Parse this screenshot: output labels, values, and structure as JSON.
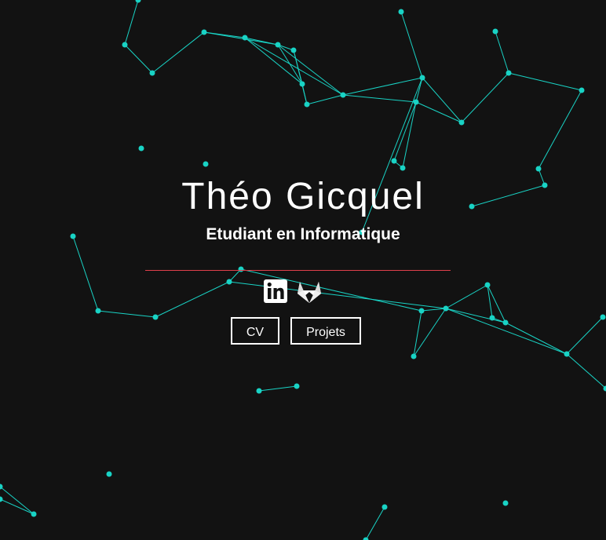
{
  "hero": {
    "name": "Théo Gicquel",
    "subtitle": "Etudiant en Informatique"
  },
  "social": {
    "linkedin_icon": "linkedin-icon",
    "gitlab_icon": "gitlab-icon"
  },
  "buttons": {
    "cv_label": "CV",
    "projects_label": "Projets"
  },
  "colors": {
    "background": "#121212",
    "network": "#19d3c5",
    "divider": "#e0404b",
    "text": "#ffffff"
  }
}
